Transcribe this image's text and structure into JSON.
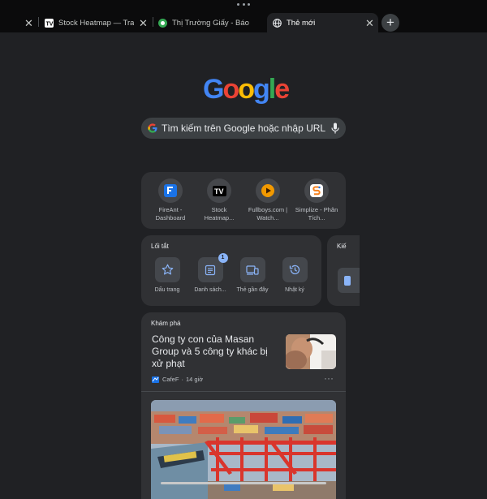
{
  "tabs": [
    {
      "title": "Stock Heatmap — TradingView",
      "favicon": "tradingview-icon",
      "active": false
    },
    {
      "title": "Thị Trường Giấy - Báo cáo",
      "favicon": "green-site-icon",
      "active": false
    },
    {
      "title": "Thẻ mới",
      "favicon": "chrome-icon",
      "active": true
    }
  ],
  "search": {
    "placeholder": "Tìm kiếm trên Google hoặc nhập URL"
  },
  "shortcuts": [
    {
      "label": "FireAnt - Dashboard",
      "icon": "fireant-icon"
    },
    {
      "label": "Stock Heatmap...",
      "icon": "tradingview-icon"
    },
    {
      "label": "Fullboys.com | Watch...",
      "icon": "fullboys-play-icon"
    },
    {
      "label": "Simplize - Phân Tích...",
      "icon": "simplize-icon"
    }
  ],
  "loitat": {
    "title": "Lối tắt",
    "items": [
      {
        "label": "Dấu trang",
        "icon": "star-icon"
      },
      {
        "label": "Danh sách...",
        "icon": "reading-list-icon",
        "badge": "1"
      },
      {
        "label": "Thẻ gần đây",
        "icon": "devices-icon"
      },
      {
        "label": "Nhật ký",
        "icon": "history-icon"
      }
    ]
  },
  "kien": {
    "title": "Kiế"
  },
  "discover": {
    "title": "Khám phá",
    "article": {
      "headline": "Công ty con của Masan Group và 5 công ty khác bị xử phạt",
      "source": "CafeF",
      "time": "14 giờ"
    }
  },
  "colors": {
    "background": "#202124",
    "card": "#303134",
    "accent": "#8ab4f8"
  }
}
